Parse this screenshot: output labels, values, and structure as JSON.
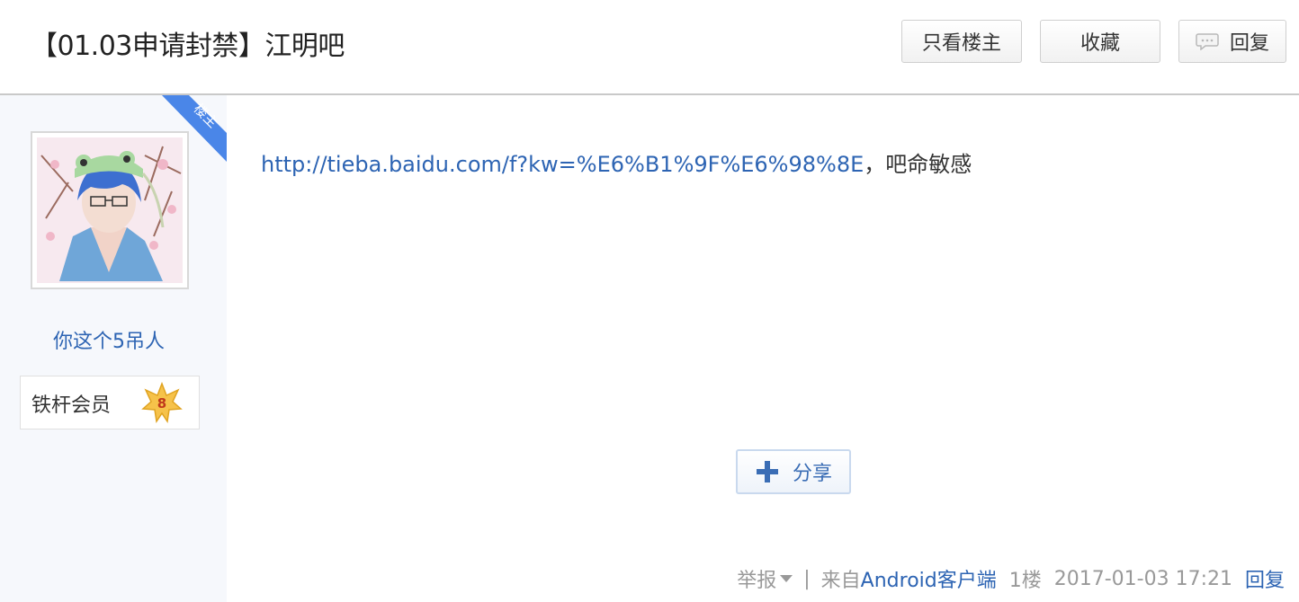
{
  "header": {
    "title": "【01.03申请封禁】江明吧",
    "buttons": {
      "only_op": "只看楼主",
      "favorite": "收藏",
      "reply": "回复"
    }
  },
  "author": {
    "corner_tag": "楼主",
    "username": "你这个5吊人",
    "member_title": "铁杆会员",
    "level": "8"
  },
  "post": {
    "link_text": "http://tieba.baidu.com/f?kw=%E6%B1%9F%E6%98%8E",
    "text_after": "，吧命敏感",
    "share_label": "分享"
  },
  "footer": {
    "report": "举报",
    "separator": "|",
    "source_prefix": "来自",
    "source_client": "Android客户端",
    "floor": "1楼",
    "timestamp": "2017-01-03 17:21",
    "reply": "回复"
  },
  "colors": {
    "link": "#2d64b3",
    "corner_tag": "#4a86e8",
    "sidebar_bg": "#f6f8fc"
  }
}
